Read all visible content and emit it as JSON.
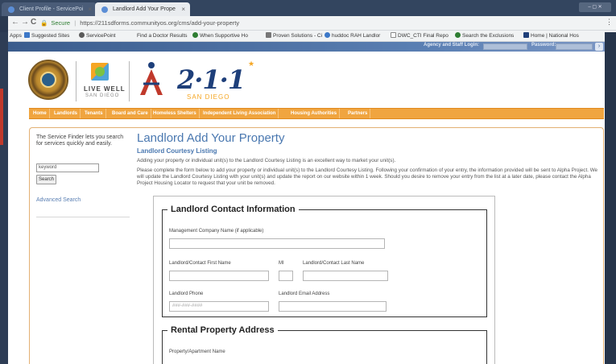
{
  "browser": {
    "tabs": [
      {
        "label": "Client Profile - ServicePoi",
        "close": "×"
      },
      {
        "label": "Landlord Add Your Prope",
        "close": "×"
      }
    ],
    "window_buttons": "– ▢ ✕",
    "nav": {
      "back": "←",
      "forward": "→",
      "reload": "C"
    },
    "address": {
      "secure_label": "Secure",
      "separator": "|",
      "url": "https://211sdforms.communityos.org/cms/add-your-property"
    },
    "menu": "⋮",
    "bookmarks": [
      {
        "label": "Apps",
        "color": "#888888"
      },
      {
        "label": "Suggested Sites",
        "color": "#3c78c8"
      },
      {
        "label": "ServicePoint",
        "color": "#5a5a5a"
      },
      {
        "label": "Find a Doctor Results",
        "color": "#d93025"
      },
      {
        "label": "When Supportive Ho",
        "color": "#2e7d32"
      },
      {
        "label": "Proven Solutions - Ci",
        "color": "#777777"
      },
      {
        "label": "huddoc RAH Landlor",
        "color": "#3c78c8"
      },
      {
        "label": "DWC_CTI Final Repo",
        "color": "#888888"
      },
      {
        "label": "Search the Exclusions",
        "color": "#2e7d32"
      },
      {
        "label": "Home | National Hos",
        "color": "#1e3f7a"
      }
    ]
  },
  "site": {
    "login": {
      "agency_label": "Agency and Staff Login:",
      "password_label": "Password:",
      "go": "›"
    },
    "logos": {
      "livewell_title": "LIVE WELL",
      "livewell_sub": "SAN DIEGO",
      "a_logo_icon": "alpha-project-logo",
      "logo211": "2·1·1",
      "logo211_star": "★",
      "logo211_sub": "SAN DIEGO"
    },
    "nav": [
      {
        "label": "Home"
      },
      {
        "label": "Landlords"
      },
      {
        "label": "Tenants"
      },
      {
        "label": "Board and Care"
      },
      {
        "label": "Homeless Shelters"
      },
      {
        "label": "Independent Living Association"
      },
      {
        "label": "Housing Authorities"
      },
      {
        "label": "Partners"
      }
    ],
    "sidebar": {
      "intro": "The Service Finder lets you search for services quickly and easily.",
      "keyword_value": "keyword",
      "search_button": "Search",
      "advanced_search": "Advanced Search"
    },
    "main": {
      "title": "Landlord Add Your Property",
      "subtitle": "Landlord Courtesy Listing",
      "p1": "Adding your property or individual unit(s) to the Landlord Courtesy Listing is an excellent way to market your unit(s).",
      "p2": "Please complete the form below to add your property or individual unit(s) to the Landlord Courtesy Listing.  Following your confirmation of your entry, the information provided will be sent to Alpha Project.  We will update the Landlord Courtesy Listing with your unit(s) and update the report on our website within 1 week.  Should you desire to remove your entry from the list at a later date, please contact the Alpha Project Housing Locator to request that your unit be removed."
    },
    "form": {
      "contact_legend": "Landlord Contact Information",
      "company_label": "Management Company Name (if applicable)",
      "first_name_label": "Landlord/Contact First Name",
      "mi_label": "MI",
      "last_name_label": "Landlord/Contact Last Name",
      "phone_label": "Landlord Phone",
      "phone_placeholder": "###-###-####",
      "email_label": "Landlord Email Address",
      "rental_legend": "Rental Property Address",
      "property_label": "Property/Apartment Name"
    }
  }
}
